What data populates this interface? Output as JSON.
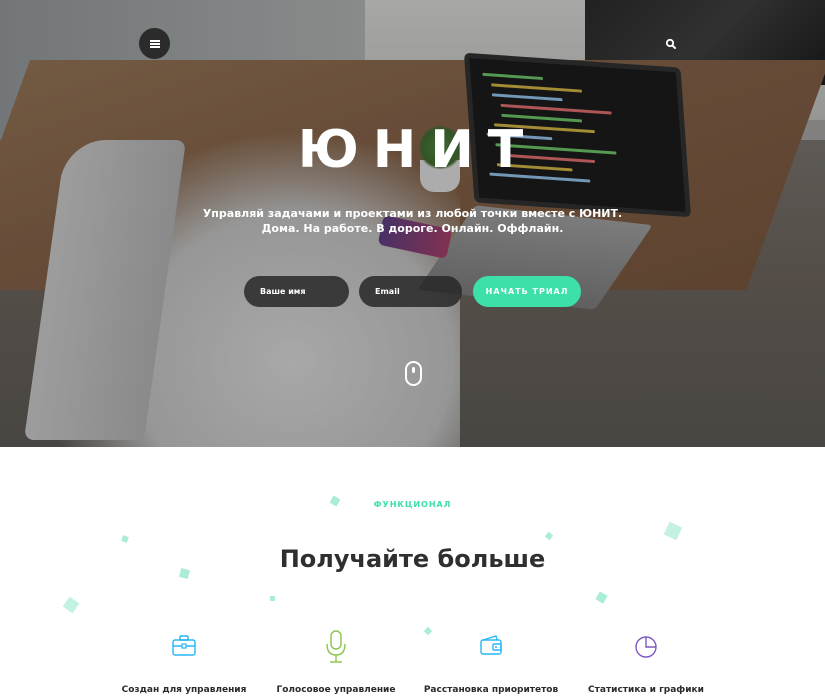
{
  "hero": {
    "brand": "ЮНИТ",
    "subtitle_line1": "Управляй задачами и проектами из любой точки вместе с ЮНИТ.",
    "subtitle_line2": "Дома. На работе. В дороге. Онлайн. Оффлайн.",
    "name_placeholder": "Ваше имя",
    "email_placeholder": "Email",
    "cta_label": "НАЧАТЬ ТРИАЛ",
    "menu_icon": "hamburger-icon",
    "search_icon": "search-icon",
    "scroll_icon": "mouse-scroll-icon"
  },
  "features_section": {
    "label": "ФУНКЦИОНАЛ",
    "title": "Получайте больше",
    "items": [
      {
        "icon": "briefcase-icon",
        "label": "Создан для управления",
        "color": "#29b6f6"
      },
      {
        "icon": "microphone-icon",
        "label": "Голосовое управление",
        "color": "#8bc34a"
      },
      {
        "icon": "wallet-icon",
        "label": "Расстановка приоритетов",
        "color": "#29b6f6"
      },
      {
        "icon": "pie-chart-icon",
        "label": "Статистика и графики",
        "color": "#7e57c2"
      }
    ]
  },
  "colors": {
    "accent": "#3ce0a8",
    "title_text": "#2f2f2f"
  }
}
